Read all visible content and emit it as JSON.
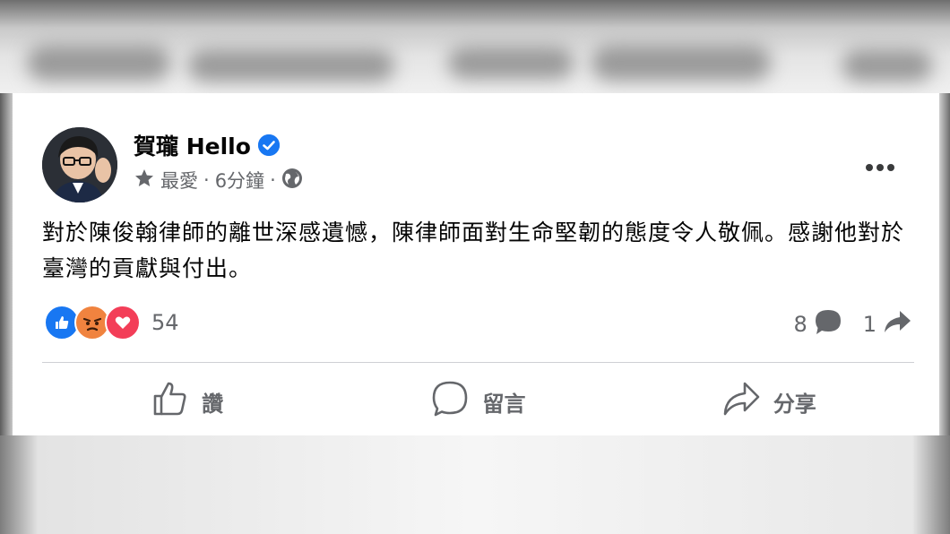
{
  "post": {
    "author": "賀瓏 Hello",
    "meta": {
      "audience": "最愛",
      "separator": "·",
      "time": "6分鐘",
      "separator2": "·"
    },
    "content": "對於陳俊翰律師的離世深感遺憾，陳律師面對生命堅韌的態度令人敬佩。感謝他對於臺灣的貢獻與付出。",
    "reactions": {
      "types": [
        "like",
        "angry",
        "love"
      ],
      "count": "54"
    },
    "stats": {
      "comments": "8",
      "shares": "1"
    },
    "actions": {
      "like": "讚",
      "comment": "留言",
      "share": "分享"
    }
  },
  "colors": {
    "like": "#1877f2",
    "angry": "#f0833f",
    "love": "#f33e58",
    "verified": "#1877f2",
    "muted": "#65676b"
  }
}
